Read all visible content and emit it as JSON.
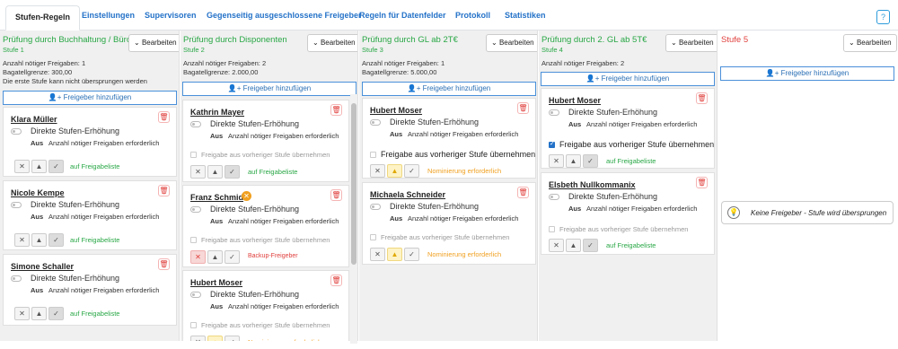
{
  "tabs": [
    "Stufen-Regeln",
    "Einstellungen",
    "Supervisoren",
    "Gegenseitig ausgeschlossene Freigeber",
    "Regeln für Datenfelder",
    "Protokoll",
    "Statistiken"
  ],
  "help_label": "?",
  "common": {
    "edit": "Bearbeiten",
    "add_approver": "Freigeber hinzufügen",
    "escalation": "Direkte Stufen-Erhöhung",
    "aus": "Aus",
    "required": "Anzahl nötiger Freigaben erforderlich",
    "adopt": "Freigabe aus vorheriger Stufe übernehmen",
    "status_list": "auf Freigabeliste",
    "status_nom": "Nominierung erforderlich",
    "status_backup": "Backup-Freigeber"
  },
  "colors": {
    "accent": "#2472c8",
    "green": "#28a745",
    "red": "#e0413e",
    "orange": "#f0a020"
  },
  "stages": [
    {
      "title": "Prüfung durch Buchhaltung / Büro",
      "sub": "Stufe 1",
      "info": [
        "Anzahl nötiger Freigaben: 1",
        "Bagatellgrenze: 300,00",
        "Die erste Stufe kann nicht übersprungen werden"
      ],
      "approvers": [
        {
          "name": "Klara Müller"
        },
        {
          "name": "Nicole Kempe"
        },
        {
          "name": "Simone Schaller"
        }
      ]
    },
    {
      "title": "Prüfung durch Disponenten",
      "sub": "Stufe 2",
      "info": [
        "Anzahl nötiger Freigaben: 2",
        "Bagatellgrenze: 2.000,00"
      ],
      "approvers": [
        {
          "name": "Kathrin Mayer"
        },
        {
          "name": "Franz Schmid"
        },
        {
          "name": "Hubert Moser"
        }
      ]
    },
    {
      "title": "Prüfung durch GL ab 2T€",
      "sub": "Stufe 3",
      "info": [
        "Anzahl nötiger Freigaben: 1",
        "Bagatellgrenze: 5.000,00"
      ],
      "approvers": [
        {
          "name": "Hubert Moser"
        },
        {
          "name": "Michaela Schneider"
        }
      ]
    },
    {
      "title": "Prüfung durch 2. GL ab 5T€",
      "sub": "Stufe 4",
      "info": [
        "Anzahl nötiger Freigaben: 2"
      ],
      "approvers": [
        {
          "name": "Hubert Moser"
        },
        {
          "name": "Elsbeth Nullkommanix"
        }
      ]
    },
    {
      "title": "Stufe 5",
      "empty_text": "Keine Freigeber - Stufe wird übersprungen"
    }
  ]
}
